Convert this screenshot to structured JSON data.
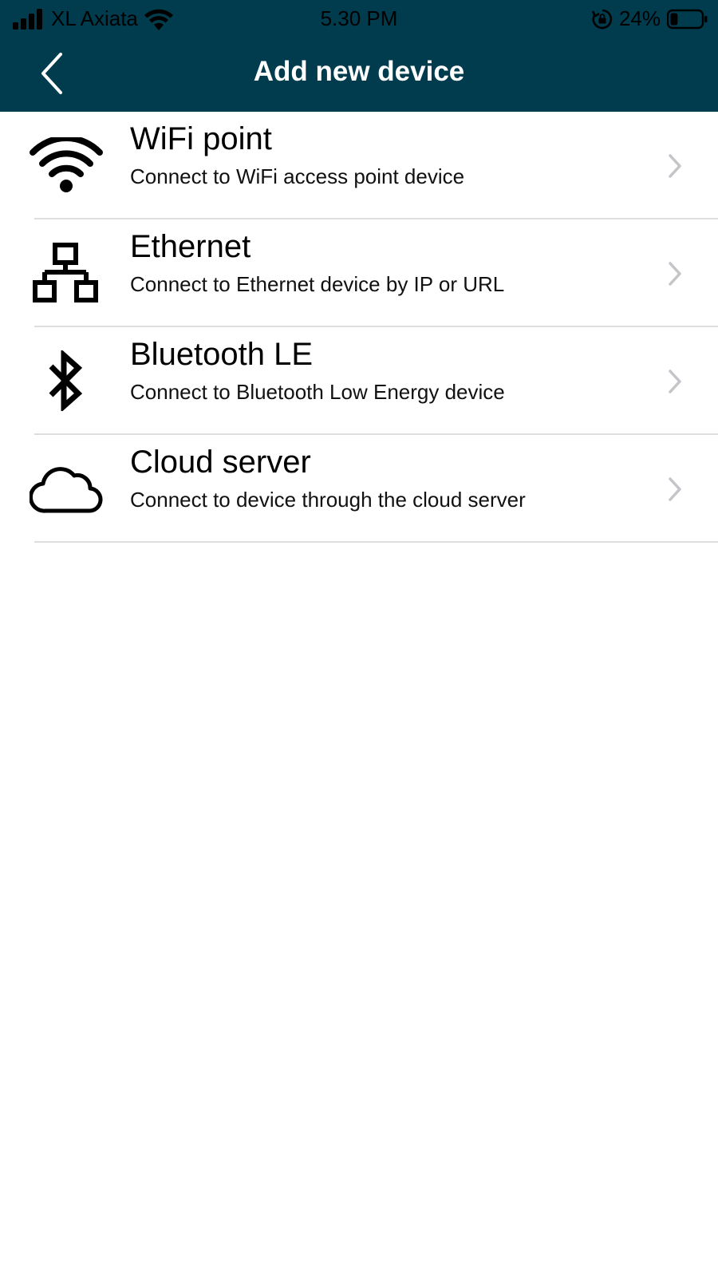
{
  "status_bar": {
    "carrier": "XL Axiata",
    "time": "5.30 PM",
    "battery_percent": "24%",
    "battery_level": 0.24,
    "icons": [
      "signal-icon",
      "wifi-icon",
      "rotation-lock-icon",
      "battery-icon"
    ]
  },
  "header": {
    "title": "Add new device",
    "back_icon": "chevron-left-icon",
    "background_color": "#003c4e"
  },
  "device_options": [
    {
      "icon": "wifi-icon",
      "label": "WiFi point",
      "description": "Connect to WiFi access point device"
    },
    {
      "icon": "ethernet-network-icon",
      "label": "Ethernet",
      "description": "Connect to Ethernet device by IP or URL"
    },
    {
      "icon": "bluetooth-icon",
      "label": "Bluetooth LE",
      "description": "Connect to Bluetooth Low Energy device"
    },
    {
      "icon": "cloud-icon",
      "label": "Cloud server",
      "description": "Connect to device through the cloud server"
    }
  ]
}
